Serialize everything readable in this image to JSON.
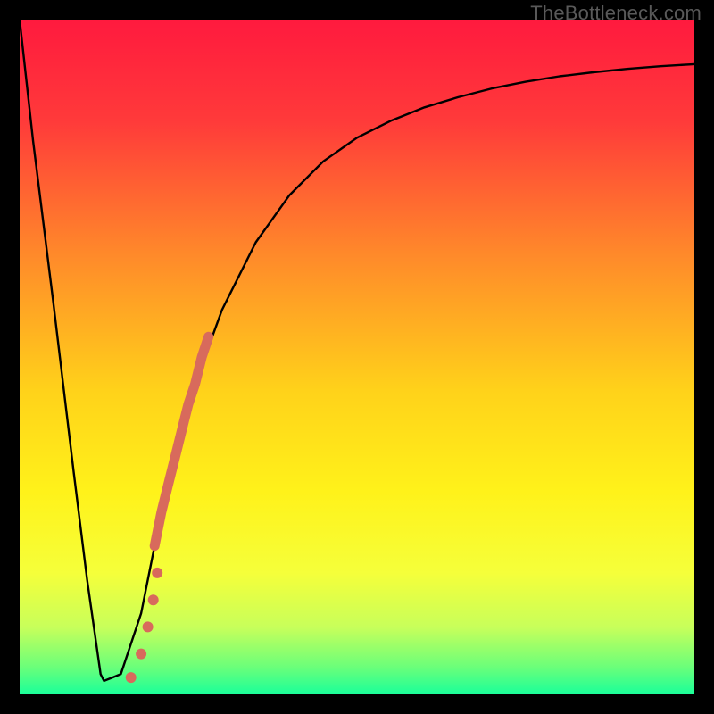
{
  "watermark": "TheBottleneck.com",
  "gradient": {
    "stops": [
      {
        "offset": 0.0,
        "color": "#ff1a3e"
      },
      {
        "offset": 0.15,
        "color": "#ff3a3a"
      },
      {
        "offset": 0.35,
        "color": "#ff8a2a"
      },
      {
        "offset": 0.55,
        "color": "#ffd21a"
      },
      {
        "offset": 0.7,
        "color": "#fff21a"
      },
      {
        "offset": 0.82,
        "color": "#f5ff3a"
      },
      {
        "offset": 0.9,
        "color": "#c8ff5a"
      },
      {
        "offset": 0.96,
        "color": "#6aff7a"
      },
      {
        "offset": 1.0,
        "color": "#1aff9a"
      }
    ]
  },
  "chart_data": {
    "type": "line",
    "title": "",
    "xlabel": "",
    "ylabel": "",
    "xlim": [
      0,
      100
    ],
    "ylim": [
      0,
      100
    ],
    "series": [
      {
        "name": "bottleneck-curve",
        "x": [
          0,
          2,
          5,
          8,
          10,
          12,
          12.5,
          15,
          18,
          20,
          23,
          26,
          30,
          35,
          40,
          45,
          50,
          55,
          60,
          65,
          70,
          75,
          80,
          85,
          90,
          95,
          100
        ],
        "values": [
          100,
          82,
          58,
          33,
          17,
          3,
          2,
          3,
          12,
          22,
          35,
          46,
          57,
          67,
          74,
          79,
          82.5,
          85,
          87,
          88.5,
          89.8,
          90.8,
          91.6,
          92.2,
          92.7,
          93.1,
          93.4
        ]
      }
    ],
    "highlight_segment": {
      "name": "dense-region",
      "color": "#d86a5c",
      "x": [
        20,
        21,
        22,
        23,
        24,
        25,
        26,
        27,
        28
      ],
      "values": [
        22,
        27,
        31,
        35,
        39,
        43,
        46,
        50,
        53
      ]
    },
    "points": {
      "name": "sample-points",
      "color": "#d86a5c",
      "x": [
        16.5,
        18.0,
        19.0,
        19.8,
        20.4
      ],
      "values": [
        2.5,
        6.0,
        10.0,
        14.0,
        18.0
      ]
    }
  }
}
